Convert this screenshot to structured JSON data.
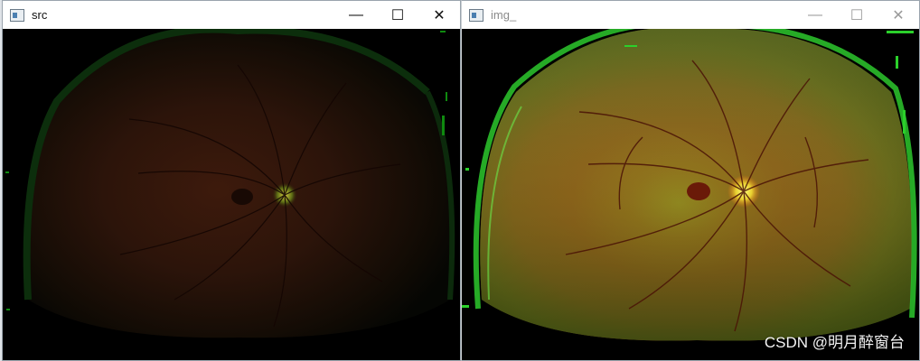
{
  "windows": {
    "src": {
      "title": "src"
    },
    "img": {
      "title": "img_"
    }
  },
  "controls": {
    "minimize_glyph": "—",
    "maximize_glyph": "☐",
    "close_glyph": "✕"
  },
  "icons": {
    "window_icon": "image-window-icon",
    "minimize": "minimize-icon",
    "maximize": "maximize-icon",
    "close": "close-icon"
  },
  "watermark": "CSDN @明月醉窗台",
  "colors": {
    "titlebar_bg": "#ffffff",
    "src_fundus_red": "#3a140a",
    "img_fundus_red": "#e0401a",
    "img_fundus_yellow": "#e7b428",
    "frame_green": "#1f8a1f"
  }
}
